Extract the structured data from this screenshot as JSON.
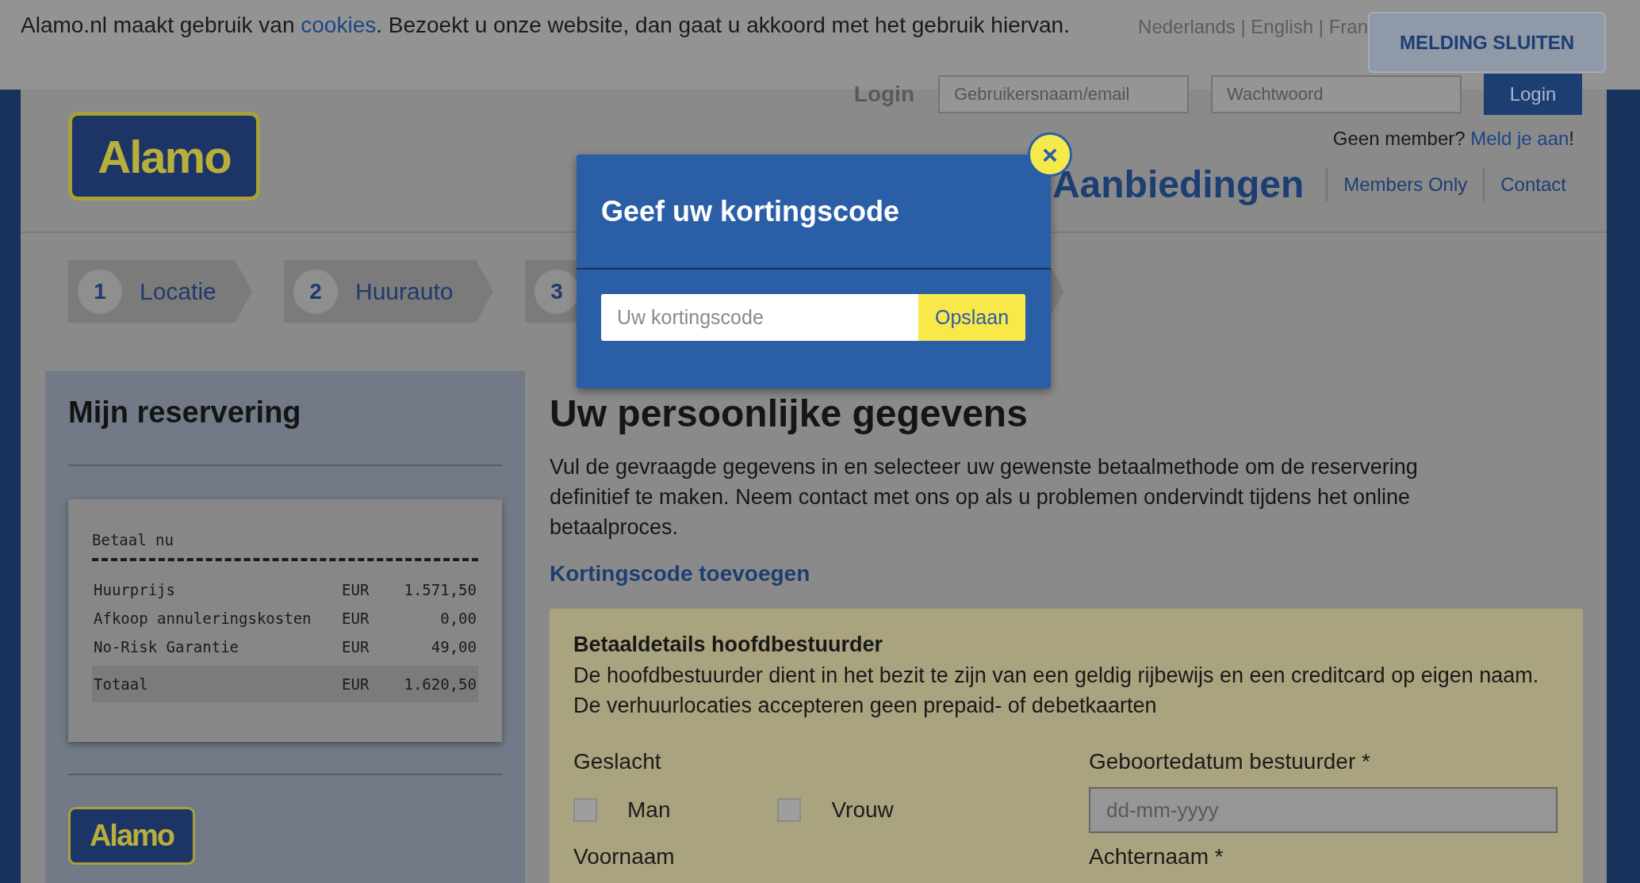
{
  "cookie_bar": {
    "text_before": "Alamo.nl maakt gebruik van ",
    "link": "cookies",
    "text_after": ". Bezoekt u onze website, dan gaat u akkoord met het gebruik hiervan.",
    "button": "MELDING SLUITEN"
  },
  "languages": "Nederlands | English | Fran",
  "login": {
    "label": "Login",
    "username_placeholder": "Gebruikersnaam/email",
    "password_placeholder": "Wachtwoord",
    "button": "Login"
  },
  "member": {
    "text": "Geen member? ",
    "link": "Meld je aan",
    "suffix": "!"
  },
  "logo": "Alamo",
  "nav": [
    {
      "label": "Aanbiedingen",
      "kind": "large"
    },
    {
      "label": "Members Only",
      "kind": "small"
    },
    {
      "label": "Contact",
      "kind": "small"
    }
  ],
  "steps": [
    {
      "number": "1",
      "label": "Locatie"
    },
    {
      "number": "2",
      "label": "Huurauto"
    },
    {
      "number": "3"
    }
  ],
  "sidebar": {
    "title": "Mijn reservering",
    "receipt": {
      "title": "Betaal nu",
      "rows": [
        {
          "label": "Huurprijs",
          "currency": "EUR",
          "amount": "1.571,50",
          "kind": "item"
        },
        {
          "label": "Afkoop annuleringskosten",
          "currency": "EUR",
          "amount": "0,00",
          "kind": "item"
        },
        {
          "label": "No-Risk Garantie",
          "currency": "EUR",
          "amount": "49,00",
          "kind": "item"
        },
        {
          "label": "Totaal",
          "currency": "EUR",
          "amount": "1.620,50",
          "kind": "total"
        }
      ]
    },
    "logo": "Alamo"
  },
  "content": {
    "title": "Uw persoonlijke gegevens",
    "intro": "Vul de gevraagde gegevens in en selecteer uw gewenste betaalmethode om de reservering definitief te maken. Neem contact met ons op als u problemen ondervindt tijdens het online betaalproces.",
    "discount_link": "Kortingscode toevoegen",
    "form": {
      "title": "Betaaldetails hoofdbestuurder",
      "description": "De hoofdbestuurder dient in het bezit te zijn van een geldig rijbewijs en een creditcard op eigen naam. De verhuurlocaties accepteren geen prepaid- of debetkaarten",
      "gender_label": "Geslacht",
      "genders": [
        {
          "label": "Man",
          "checked": false
        },
        {
          "label": "Vrouw",
          "checked": false
        }
      ],
      "birthdate_label": "Geboortedatum bestuurder *",
      "birthdate_placeholder": "dd-mm-yyyy",
      "firstname_label": "Voornaam",
      "lastname_label": "Achternaam *"
    }
  },
  "modal": {
    "title": "Geef uw kortingscode",
    "placeholder": "Uw kortingscode",
    "button": "Opslaan",
    "close": "×"
  }
}
